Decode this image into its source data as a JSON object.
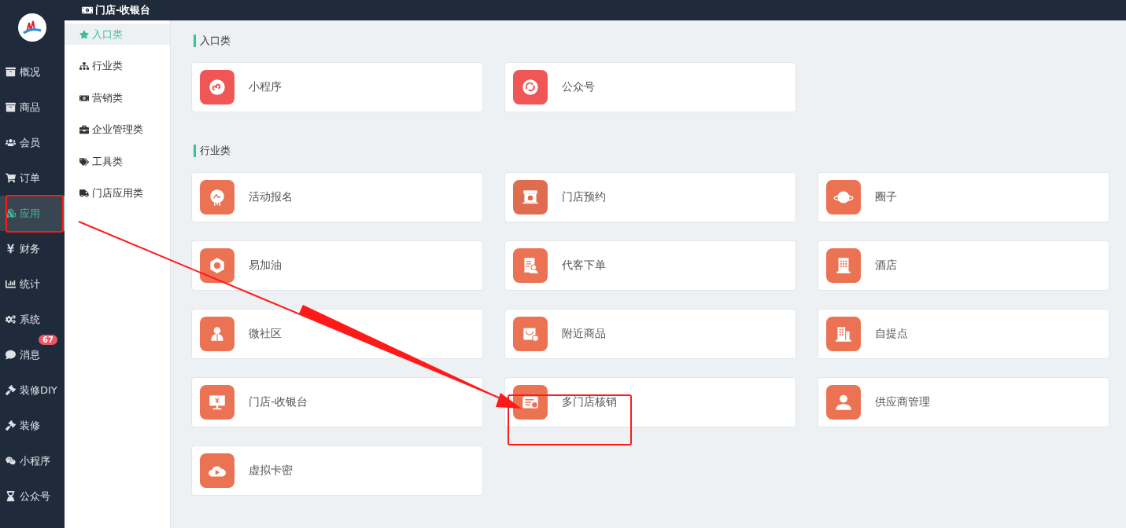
{
  "topbar": {
    "title": "门店-收银台"
  },
  "nav": [
    {
      "kind": "archive",
      "label": "概况",
      "selected": false
    },
    {
      "kind": "archive",
      "label": "商品",
      "selected": false
    },
    {
      "kind": "users",
      "label": "会员",
      "selected": false
    },
    {
      "kind": "cart",
      "label": "订单",
      "selected": false
    },
    {
      "kind": "cubes",
      "label": "应用",
      "selected": true
    },
    {
      "kind": "yen",
      "label": "财务",
      "selected": false
    },
    {
      "kind": "chart",
      "label": "统计",
      "selected": false
    },
    {
      "kind": "cogs",
      "label": "系统",
      "selected": false
    },
    {
      "kind": "comment",
      "label": "消息",
      "selected": false,
      "badge": "67"
    },
    {
      "kind": "gavel",
      "label": "装修DIY",
      "selected": false
    },
    {
      "kind": "gavel",
      "label": "装修",
      "selected": false
    },
    {
      "kind": "wechat",
      "label": "小程序",
      "selected": false
    },
    {
      "kind": "hourglass",
      "label": "公众号",
      "selected": false
    }
  ],
  "subnav": [
    {
      "kind": "star",
      "label": "入口类",
      "selected": true
    },
    {
      "kind": "sitemap",
      "label": "行业类",
      "selected": false
    },
    {
      "kind": "money",
      "label": "营销类",
      "selected": false
    },
    {
      "kind": "briefcase",
      "label": "企业管理类",
      "selected": false
    },
    {
      "kind": "tags",
      "label": "工具类",
      "selected": false
    },
    {
      "kind": "truck",
      "label": "门店应用类",
      "selected": false
    }
  ],
  "sections": [
    {
      "title": "入口类",
      "cards": [
        {
          "kind": "miniprogram",
          "label": "小程序",
          "color": "#f05656"
        },
        {
          "kind": "official",
          "label": "公众号",
          "color": "#f05656"
        }
      ]
    },
    {
      "title": "行业类",
      "cards": [
        {
          "kind": "event",
          "label": "活动报名",
          "color": "#ec7254"
        },
        {
          "kind": "store",
          "label": "门店预约",
          "color": "#e06c50"
        },
        {
          "kind": "planet",
          "label": "圈子",
          "color": "#ec7254"
        },
        {
          "kind": "fuel",
          "label": "易加油",
          "color": "#ec7254"
        },
        {
          "kind": "order",
          "label": "代客下单",
          "color": "#ec7254"
        },
        {
          "kind": "hotel",
          "label": "酒店",
          "color": "#ec7254"
        },
        {
          "kind": "community",
          "label": "微社区",
          "color": "#ec7254"
        },
        {
          "kind": "nearby",
          "label": "附近商品",
          "color": "#ec7254"
        },
        {
          "kind": "pickup",
          "label": "自提点",
          "color": "#ec7254"
        },
        {
          "kind": "cashier",
          "label": "门店-收银台",
          "color": "#ec7254"
        },
        {
          "kind": "verify",
          "label": "多门店核销",
          "color": "#ec7254"
        },
        {
          "kind": "supplier",
          "label": "供应商管理",
          "color": "#ec7254"
        },
        {
          "kind": "cloud",
          "label": "虚拟卡密",
          "color": "#ec7254"
        }
      ]
    }
  ]
}
